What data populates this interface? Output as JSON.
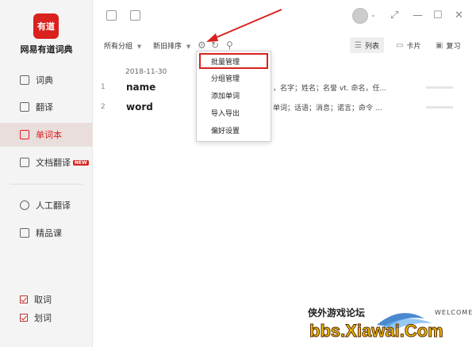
{
  "app": {
    "logo_text": "有道",
    "name": "网易有道词典"
  },
  "sidebar": {
    "items": [
      {
        "label": "词典",
        "icon": "dict-icon",
        "active": false
      },
      {
        "label": "翻译",
        "icon": "translate-icon",
        "active": false
      },
      {
        "label": "单词本",
        "icon": "wordbook-icon",
        "active": true
      },
      {
        "label": "文档翻译",
        "icon": "doc-translate-icon",
        "active": false,
        "badge": "NEW"
      },
      {
        "label": "人工翻译",
        "icon": "human-translate-icon",
        "active": false
      },
      {
        "label": "精品课",
        "icon": "course-icon",
        "active": false
      }
    ],
    "checks": [
      {
        "label": "取词",
        "checked": true
      },
      {
        "label": "划词",
        "checked": true
      }
    ]
  },
  "toolbar": {
    "group_filter": "所有分组",
    "sort_filter": "新旧排序",
    "views": [
      {
        "label": "列表",
        "active": true
      },
      {
        "label": "卡片",
        "active": false
      },
      {
        "label": "复习",
        "active": false
      }
    ]
  },
  "wordbook": {
    "date": "2018-11-30",
    "rows": [
      {
        "index": "1",
        "word": "name",
        "definition": "，名字；姓名；名誉  vt. 命名，任..."
      },
      {
        "index": "2",
        "word": "word",
        "definition": "单词；话语；消息；诺言；命令  ..."
      }
    ]
  },
  "dropdown_menu": {
    "items": [
      "批量管理",
      "分组管理",
      "添加单词",
      "导入导出",
      "偏好设置"
    ]
  },
  "watermark": {
    "title": "侠外游戏论坛",
    "welcome": "WELCOME",
    "url": "bbs.Xiawai.Com"
  },
  "colors": {
    "accent": "#d9211d",
    "sidebar_bg": "#f4f4f4",
    "active_bg": "#eadedd"
  }
}
